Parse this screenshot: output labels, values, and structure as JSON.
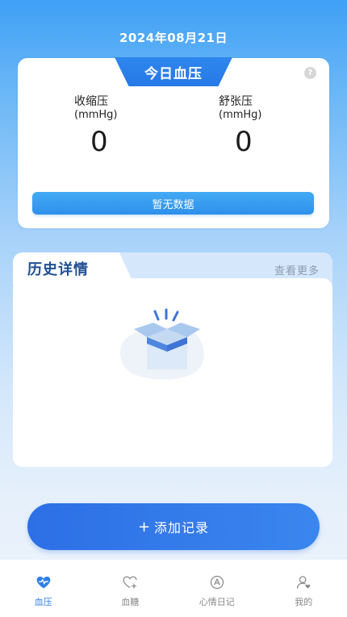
{
  "header": {
    "date": "2024年08月21日"
  },
  "today_card": {
    "title": "今日血压",
    "help_icon": "question-icon",
    "help_glyph": "?",
    "systolic": {
      "label": "收缩压",
      "unit": "(mmHg)",
      "value": "0"
    },
    "diastolic": {
      "label": "舒张压",
      "unit": "(mmHg)",
      "value": "0"
    },
    "status_text": "暂无数据"
  },
  "history": {
    "title": "历史详情",
    "more_link": "查看更多",
    "empty_icon": "empty-box-icon"
  },
  "add_button": {
    "plus": "+",
    "label": "添加记录"
  },
  "tabbar": {
    "items": [
      {
        "label": "血压",
        "icon": "heart-pulse-icon",
        "active": true
      },
      {
        "label": "血糖",
        "icon": "heart-plus-icon",
        "active": false
      },
      {
        "label": "心情日记",
        "icon": "mood-icon",
        "active": false
      },
      {
        "label": "我的",
        "icon": "user-icon",
        "active": false
      }
    ]
  },
  "colors": {
    "accent": "#2f7fe8",
    "tab_title_bg": "#2679e6",
    "no_data_bar": "#3a9cf0",
    "history_title": "#1f4f95"
  }
}
